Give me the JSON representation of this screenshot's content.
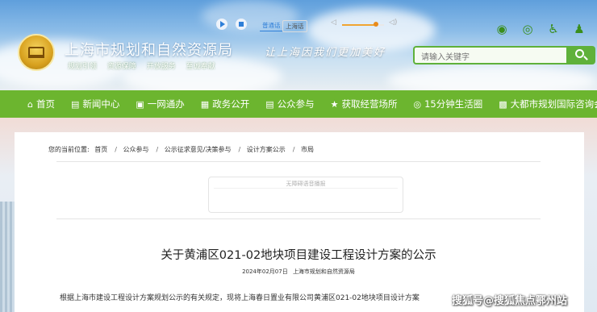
{
  "header": {
    "site_title": "上海市规划和自然资源局",
    "tags": [
      "规划引领",
      "资源保障",
      "开放服务",
      "至诚奉献"
    ],
    "slogan": "让上海因我们更加美好",
    "icons": [
      "wechat-icon",
      "weibo-icon",
      "accessibility-icon",
      "user-icon"
    ],
    "search": {
      "placeholder": "请输入关键字",
      "value": ""
    }
  },
  "nav": {
    "items": [
      {
        "icon": "⌂",
        "label": "首页"
      },
      {
        "icon": "▤",
        "label": "新闻中心"
      },
      {
        "icon": "▣",
        "label": "一网通办"
      },
      {
        "icon": "▦",
        "label": "政务公开"
      },
      {
        "icon": "▤",
        "label": "公众参与"
      },
      {
        "icon": "★",
        "label": "获取经营场所"
      },
      {
        "icon": "◎",
        "label": "15分钟生活圈"
      },
      {
        "icon": "▩",
        "label": "大都市规划国际咨询会"
      }
    ]
  },
  "breadcrumb": {
    "prefix": "您的当前位置:",
    "items": [
      "首页",
      "公众参与",
      "公示征求意见/决策参与",
      "设计方案公示",
      "市局"
    ]
  },
  "player": {
    "title": "无障碍语音播报",
    "lang_active": "普通话",
    "lang_other": "上海话",
    "volume_level": 0.8
  },
  "article": {
    "title": "关于黄浦区021-02地块项目建设工程设计方案的公示",
    "date": "2024年02月07日",
    "source": "上海市规划和自然资源局",
    "body": "根据上海市建设工程设计方案规划公示的有关规定，现将上海春日置业有限公司黄浦区021-02地块项目设计方案"
  },
  "watermark": "搜狐号@搜狐焦点鄂州站",
  "colors": {
    "nav_green": "#6cb52f",
    "search_green": "#5fb13a",
    "accent_blue": "#2f7fd8",
    "volume_orange": "#e88b1b"
  }
}
